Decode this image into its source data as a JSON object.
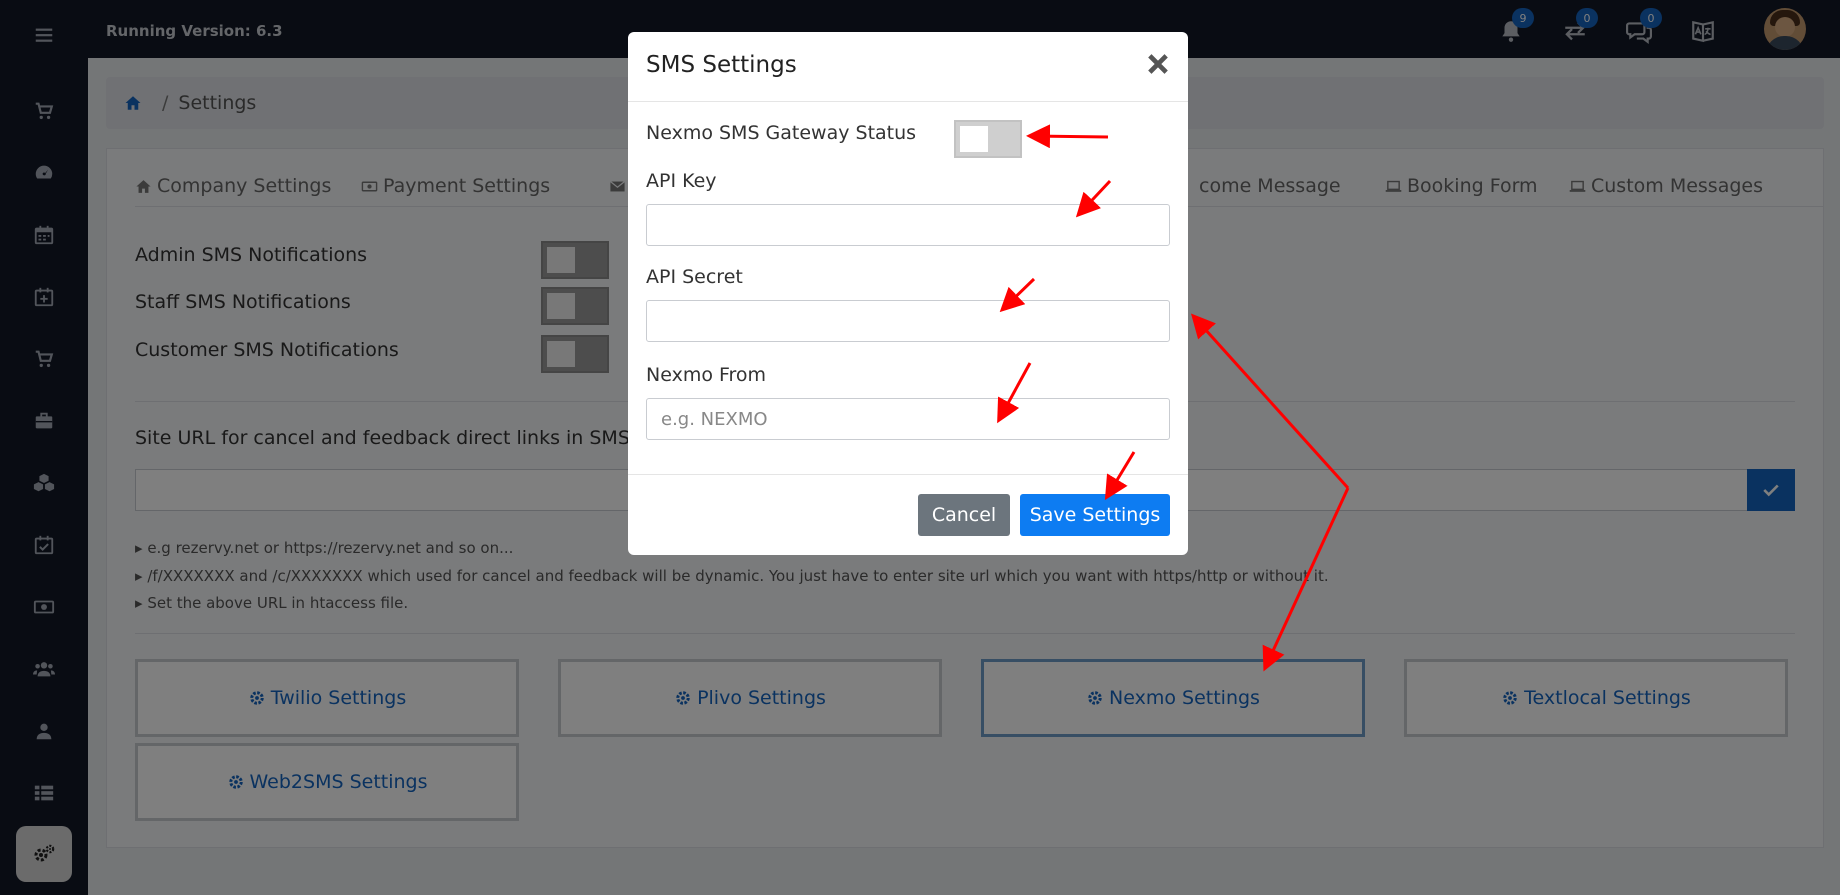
{
  "topbar": {
    "version": "Running Version: 6.3",
    "notifications_count": "9",
    "transfers_count": "0",
    "messages_count": "0"
  },
  "breadcrumb": {
    "current": "Settings"
  },
  "tabs": [
    {
      "label": "Company Settings"
    },
    {
      "label": "Payment Settings"
    },
    {
      "label": "Em"
    },
    {
      "label": "come Message"
    },
    {
      "label": "Booking Form"
    },
    {
      "label": "Custom Messages"
    }
  ],
  "notifications": [
    {
      "label": "Admin SMS Notifications"
    },
    {
      "label": "Staff SMS Notifications"
    },
    {
      "label": "Customer SMS Notifications"
    }
  ],
  "site_url": {
    "label": "Site URL for cancel and feedback direct links in SMS",
    "notes": [
      "e.g rezervy.net or https://rezervy.net and so on...",
      "/f/XXXXXXX and /c/XXXXXXX which used for cancel and feedback will be dynamic. You just have to enter site url which you want with https/http or without it.",
      "Set the above URL in htaccess file."
    ]
  },
  "gateways": [
    {
      "label": "Twilio Settings"
    },
    {
      "label": "Plivo Settings"
    },
    {
      "label": "Nexmo Settings"
    },
    {
      "label": "Textlocal Settings"
    },
    {
      "label": "Web2SMS Settings"
    }
  ],
  "modal": {
    "title": "SMS Settings",
    "status_label": "Nexmo SMS Gateway Status",
    "api_key_label": "API Key",
    "api_key_value": "",
    "api_secret_label": "API Secret",
    "api_secret_value": "",
    "from_label": "Nexmo From",
    "from_placeholder": "e.g. NEXMO",
    "cancel_label": "Cancel",
    "save_label": "Save Settings"
  },
  "colors": {
    "sidebar": "#121826",
    "primary": "#0d7cf2",
    "link": "#1565c0",
    "annotation": "#ff0000"
  }
}
